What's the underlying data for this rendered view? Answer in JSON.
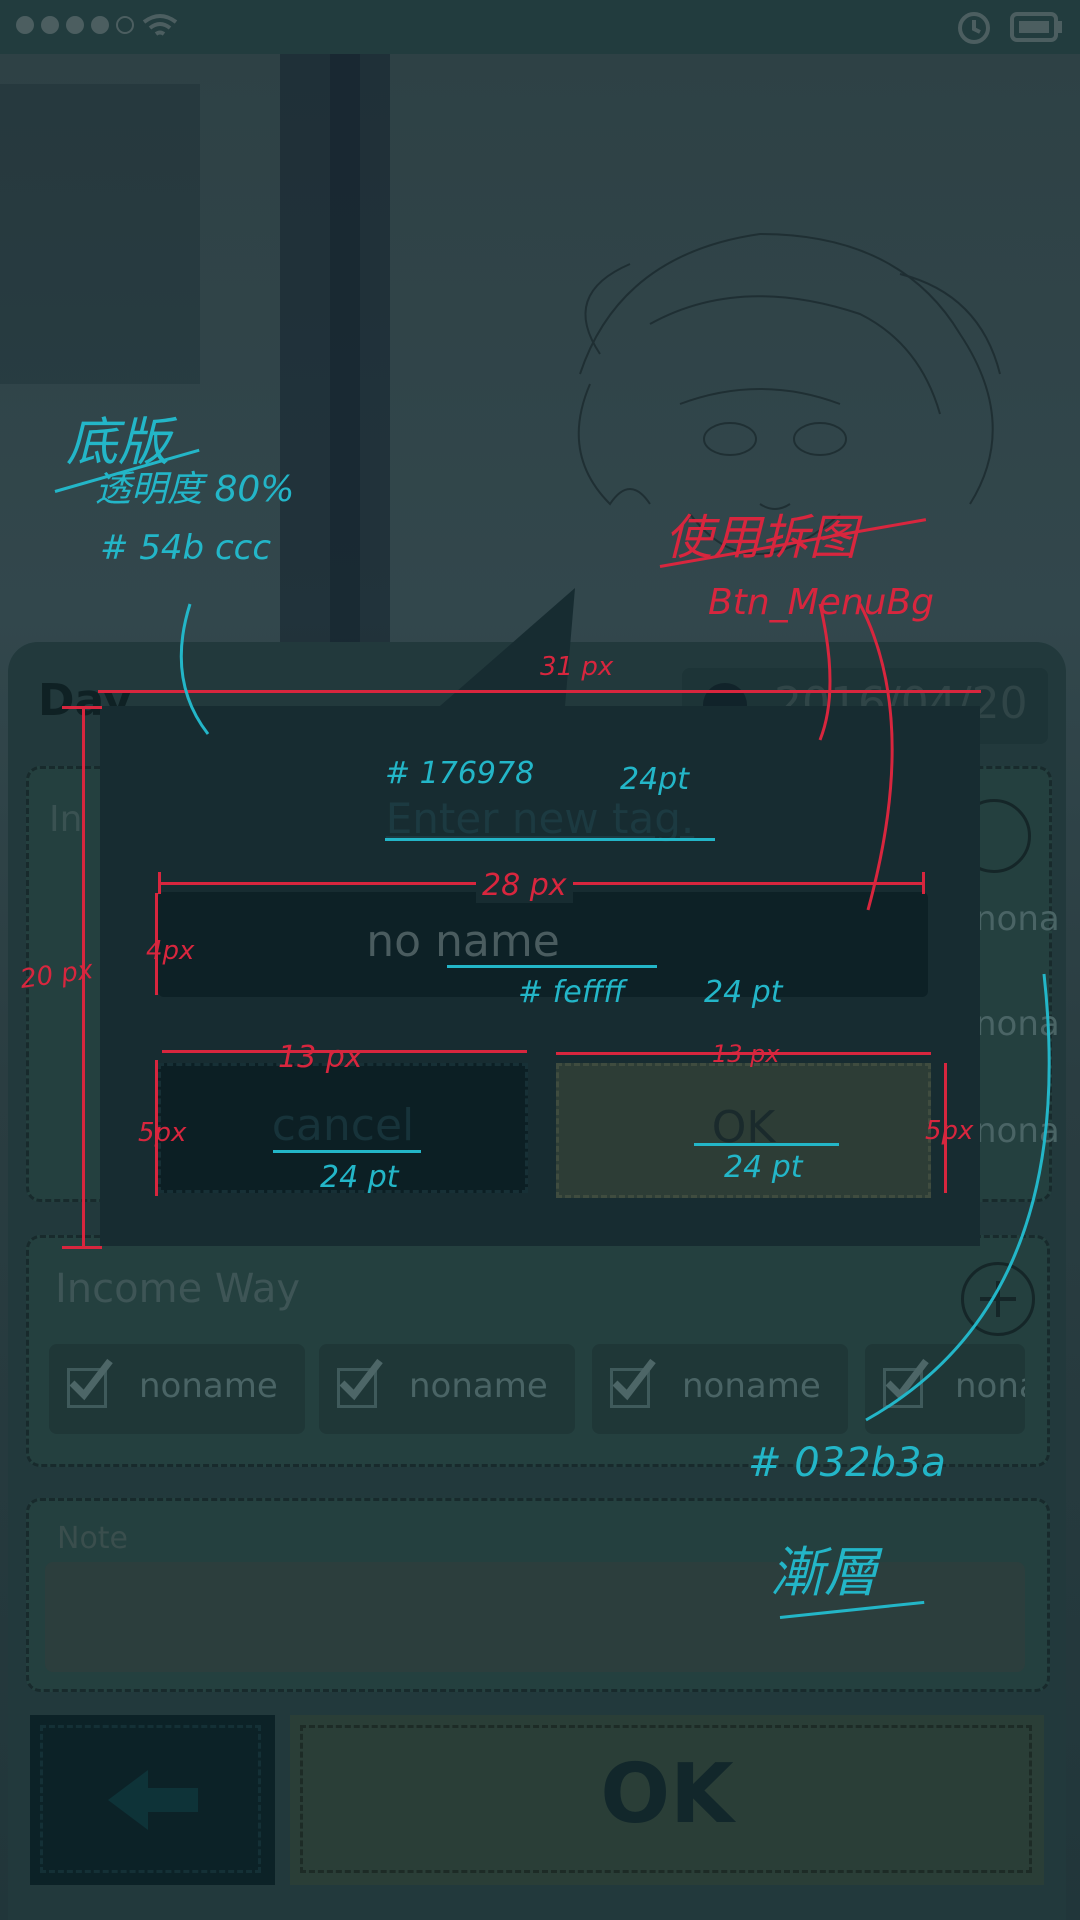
{
  "status_bar": {
    "icons": [
      "signal-dots-icon",
      "wifi-icon",
      "sync-icon",
      "battery-icon"
    ]
  },
  "header": {
    "date_label": "Day",
    "date_value": "2016/04/20"
  },
  "dialog": {
    "title": "Enter new tag.",
    "name_value": "no name",
    "cancel_label": "cancel",
    "ok_label": "OK"
  },
  "sections": {
    "income_type": {
      "title": "In",
      "chips": [
        "nona",
        "nona",
        "nona"
      ]
    },
    "income_way": {
      "title": "Income Way",
      "chips": [
        "noname",
        "noname",
        "noname",
        "nona"
      ]
    },
    "note": {
      "title": "Note"
    }
  },
  "bottom": {
    "ok_label": "OK"
  },
  "annotations": {
    "base_title": "底版",
    "opacity": "透明度 80%",
    "base_color": "# 54b ccc",
    "use_sliced": "使用拆图",
    "btn_menu_bg": "Btn_MenuBg",
    "w31": "31 px",
    "color_title": "# 176978",
    "size_title": "24pt",
    "w28": "28 px",
    "h4": "4px",
    "color_name": "# feffff",
    "size_name": "24 pt",
    "h20": "20 px",
    "w13a": "13 px",
    "w13b": "13 px",
    "h5a": "5px",
    "h5b": "5px",
    "size_cancel": "24 pt",
    "size_ok": "24 pt",
    "color_grad": "# 032b3a",
    "gradient": "漸層"
  },
  "colors": {
    "accent_red": "#d8263e",
    "annot_cyan": "#23b6c8",
    "panel": "#22393c"
  }
}
